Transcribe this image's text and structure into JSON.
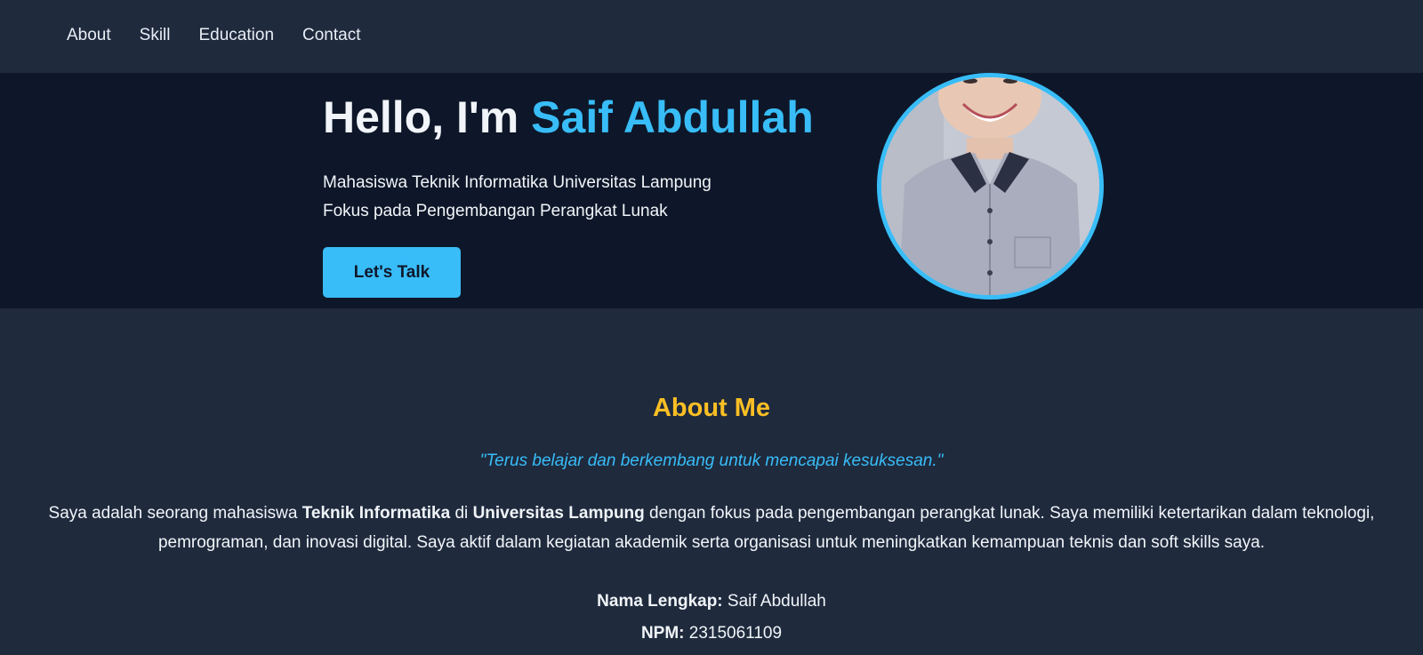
{
  "nav": {
    "items": [
      {
        "label": "About"
      },
      {
        "label": "Skill"
      },
      {
        "label": "Education"
      },
      {
        "label": "Contact"
      }
    ]
  },
  "hero": {
    "greeting": "Hello, I'm ",
    "name": "Saif Abdullah",
    "subtitle_line1": "Mahasiswa Teknik Informatika Universitas Lampung",
    "subtitle_line2": "Fokus pada Pengembangan Perangkat Lunak",
    "cta_label": "Let's Talk"
  },
  "about": {
    "title": "About Me",
    "quote": "\"Terus belajar dan berkembang untuk mencapai kesuksesan.\"",
    "bio": {
      "part1": "Saya adalah seorang mahasiswa ",
      "bold1": "Teknik Informatika",
      "part2": " di ",
      "bold2": "Universitas Lampung",
      "part3": " dengan fokus pada pengembangan perangkat lunak. Saya memiliki ketertarikan dalam teknologi, pemrograman, dan inovasi digital. Saya aktif dalam kegiatan akademik serta organisasi untuk meningkatkan kemampuan teknis dan soft skills saya."
    },
    "details": {
      "name_label": "Nama Lengkap:",
      "name_value": " Saif Abdullah",
      "npm_label": "NPM:",
      "npm_value": " 2315061109"
    }
  },
  "colors": {
    "accent": "#38bdf8",
    "heading_accent": "#fbbf24",
    "nav_bg": "#1f2a3d",
    "hero_bg": "#0e1729"
  }
}
